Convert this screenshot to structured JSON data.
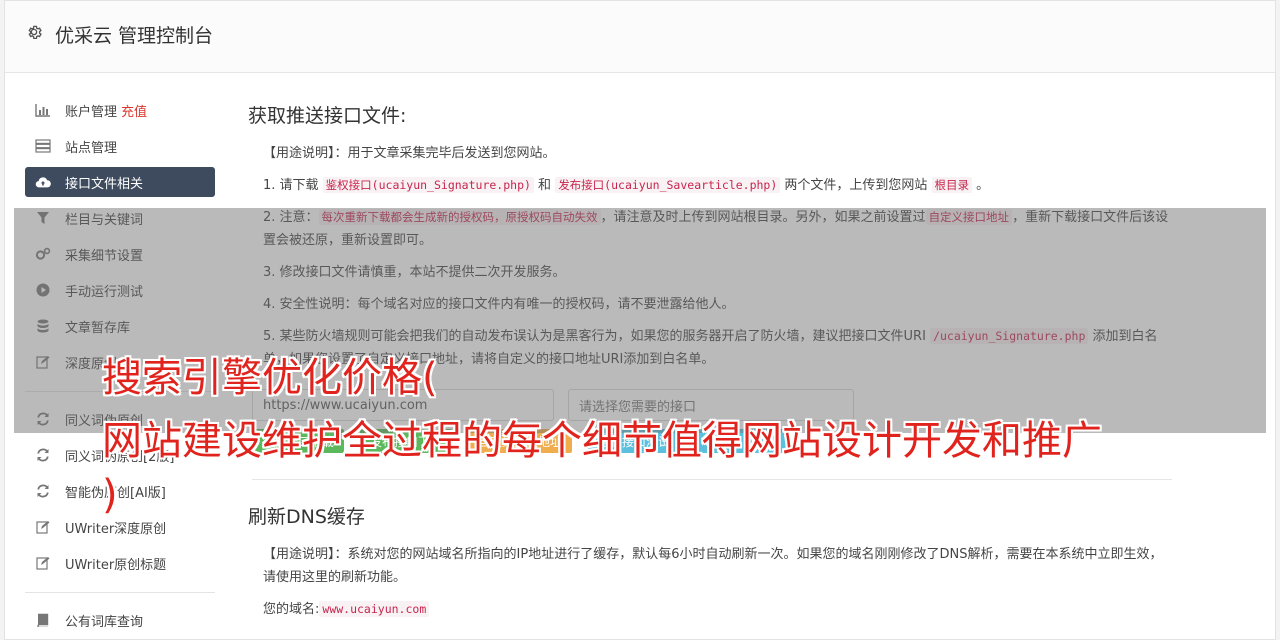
{
  "header": {
    "title": "优采云 管理控制台"
  },
  "sidebar": {
    "items": [
      {
        "label": "账户管理",
        "extra": "充值",
        "icon": "bar-chart-icon"
      },
      {
        "label": "站点管理",
        "icon": "server-icon"
      },
      {
        "label": "接口文件相关",
        "icon": "cloud-upload-icon",
        "active": true
      },
      {
        "label": "栏目与关键词",
        "icon": "filter-icon"
      },
      {
        "label": "采集细节设置",
        "icon": "gears-icon"
      },
      {
        "label": "手动运行测试",
        "icon": "play-circle-icon"
      },
      {
        "label": "文章暂存库",
        "icon": "database-icon"
      },
      {
        "label": "深度原创",
        "icon": "edit-icon"
      },
      {
        "label": "同义词伪原创",
        "icon": "refresh-icon"
      },
      {
        "label": "同义词伪原创[2版]",
        "icon": "refresh-icon"
      },
      {
        "label": "智能伪原创[AI版]",
        "icon": "refresh-icon"
      },
      {
        "label": "UWriter深度原创",
        "icon": "edit-icon"
      },
      {
        "label": "UWriter原创标题",
        "icon": "edit-icon"
      },
      {
        "label": "公有词库查询",
        "icon": "book-icon"
      }
    ]
  },
  "main": {
    "section1": {
      "title": "获取推送接口文件:",
      "usage_prefix": "【用途说明】：",
      "usage_text": "用于文章采集完毕后发送到您网站。",
      "step1": {
        "a": "1. 请下载 ",
        "c1": "鉴权接口(ucaiyun_Signature.php)",
        "b": " 和 ",
        "c2": "发布接口(ucaiyun_Savearticle.php)",
        "c": " 两个文件，上传到您网站 ",
        "c3": "根目录",
        "d": " 。"
      },
      "step2": {
        "a": "2. 注意：",
        "c1": "每次重新下载都会生成新的授权码，原授权码自动失效",
        "b": "，请注意及时上传到网站根目录。另外，如果之前设置过",
        "c2": "自定义接口地址",
        "c": "，重新下载接口文件后该设置会被还原，重新设置即可。"
      },
      "step3": "3. 修改接口文件请慎重，本站不提供二次开发服务。",
      "step4": "4. 安全性说明：每个域名对应的接口文件内有唯一的授权码，请不要泄露给他人。",
      "step5": {
        "a": "5. 某些防火墙规则可能会把我们的自动发布误认为是黑客行为，如果您的服务器开启了防火墙，建议把接口文件URI ",
        "c1": "/ucaiyun_Signature.php",
        "b": " 添加到白名单，如果您设置了自定义接口地址，请将自定义的接口地址URI添加到白名单。"
      },
      "site_input_value": "https://www.ucaiyun.com",
      "select_placeholder": "请选择您需要的接口",
      "buttons": {
        "sign_download": "鉴权接口下载",
        "publish_download": "发布接口下载",
        "custom_sign": "自定义鉴权地址",
        "sign_test": "鉴权接口测试",
        "publish_test": "发布接口测试"
      }
    },
    "section2": {
      "title": "刷新DNS缓存",
      "usage_prefix": "【用途说明】：",
      "usage_text": "系统对您的网站域名所指向的IP地址进行了缓存，默认每6小时自动刷新一次。如果您的域名刚刚修改了DNS解析，需要在本系统中立即生效，请使用这里的刷新功能。",
      "domain_label": "您的域名:",
      "domain_value": "www.ucaiyun.com"
    }
  },
  "watermark": {
    "line1": "搜索引擎优化价格(",
    "line2": "网站建设维护全过程的每个细节值得网站设计开发和推广",
    "line3": ")"
  },
  "colors": {
    "active_bg": "#3e4a5e",
    "accent_red": "#e0231d",
    "code_red": "#c7254e"
  }
}
